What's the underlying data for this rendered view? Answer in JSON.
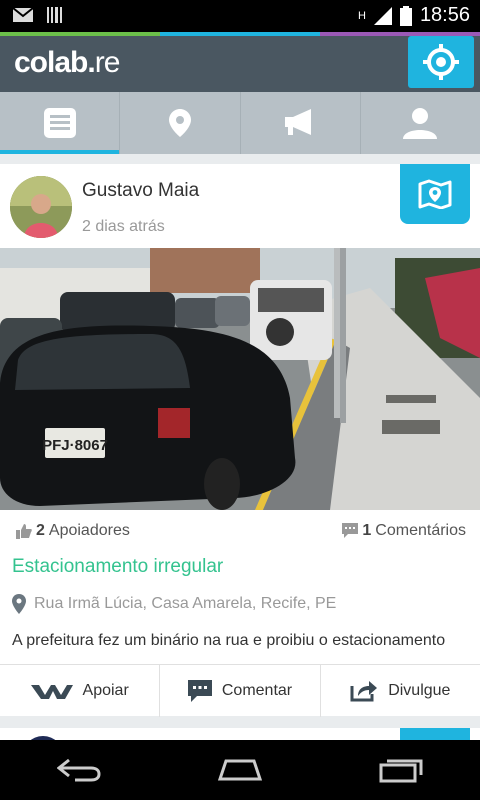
{
  "status_bar": {
    "time": "18:56",
    "network": "H",
    "icons": [
      "gmail-icon",
      "barcode-icon",
      "signal-icon",
      "battery-icon"
    ]
  },
  "accent_colors": [
    "#6cc04a",
    "#1fb4df",
    "#9b59b6"
  ],
  "app": {
    "logo_main": "colab.",
    "logo_suffix": "re",
    "locate_icon": "crosshair-icon"
  },
  "tabs": [
    {
      "icon": "list-icon",
      "active": true
    },
    {
      "icon": "map-pin-icon",
      "active": false
    },
    {
      "icon": "megaphone-icon",
      "active": false
    },
    {
      "icon": "user-icon",
      "active": false
    }
  ],
  "post": {
    "author": "Gustavo Maia",
    "time_ago": "2 dias atrás",
    "supporters_count": "2",
    "supporters_label": "Apoiadores",
    "comments_count": "1",
    "comments_label": "Comentários",
    "title": "Estacionamento irregular",
    "address": "Rua Irmã Lúcia, Casa Amarela, Recife, PE",
    "description": "A prefeitura fez um binário na rua e proibiu o estacionamento",
    "plate": "PFJ·8067"
  },
  "actions": {
    "support": "Apoiar",
    "comment": "Comentar",
    "share": "Divulgue"
  }
}
